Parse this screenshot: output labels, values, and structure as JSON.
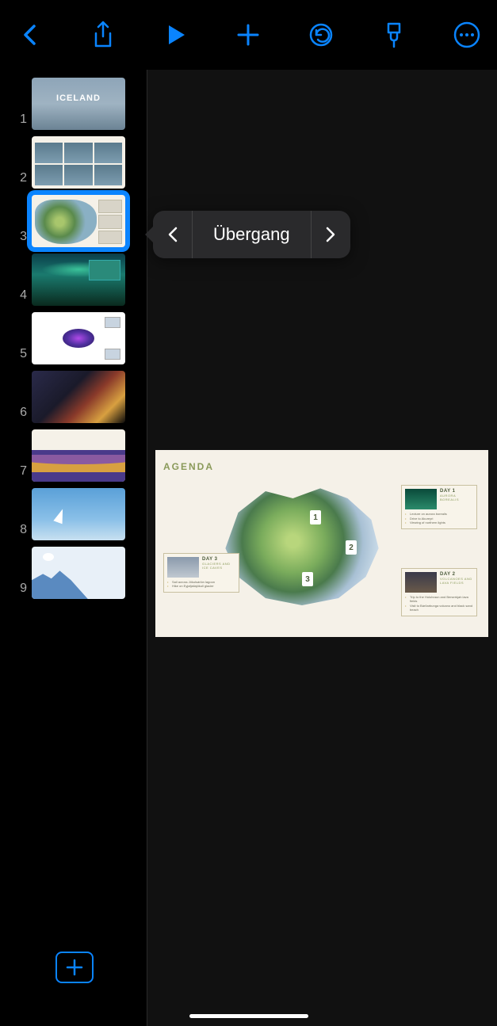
{
  "toolbar": {
    "back": "chevron-left",
    "share": "share",
    "play": "play",
    "add": "plus",
    "undo": "undo",
    "format": "paintbrush",
    "more": "ellipsis"
  },
  "popover": {
    "label": "Übergang"
  },
  "sidebar": {
    "thumbs": [
      {
        "num": "1",
        "id": "s1",
        "selected": false
      },
      {
        "num": "2",
        "id": "s2",
        "selected": false
      },
      {
        "num": "3",
        "id": "s3",
        "selected": true
      },
      {
        "num": "4",
        "id": "s4",
        "selected": false
      },
      {
        "num": "5",
        "id": "s5",
        "selected": false
      },
      {
        "num": "6",
        "id": "s6",
        "selected": false
      },
      {
        "num": "7",
        "id": "s7",
        "selected": false
      },
      {
        "num": "8",
        "id": "s8",
        "selected": false
      },
      {
        "num": "9",
        "id": "s9",
        "selected": false
      }
    ]
  },
  "slide": {
    "title": "AGENDA",
    "pins": [
      "1",
      "2",
      "3"
    ],
    "day1": {
      "title": "DAY 1",
      "subtitle": "AURORA BOREALIS",
      "bullets": [
        "Lecture on aurora borealis",
        "Drive to Akureyri",
        "Viewing of northern lights"
      ]
    },
    "day2": {
      "title": "DAY 2",
      "subtitle": "VOLCANOES AND LAVA FIELDS",
      "bullets": [
        "Trip to the Holuhraun and Berserkjah lava fields",
        "Visit to Bárðarbunga volcano and black sand beach"
      ]
    },
    "day3": {
      "title": "DAY 3",
      "subtitle": "GLACIERS AND ICE CAVES",
      "bullets": [
        "Sail across Jökulsárlón lagoon",
        "Hike on Eyjafjallajökull glacier"
      ]
    }
  }
}
